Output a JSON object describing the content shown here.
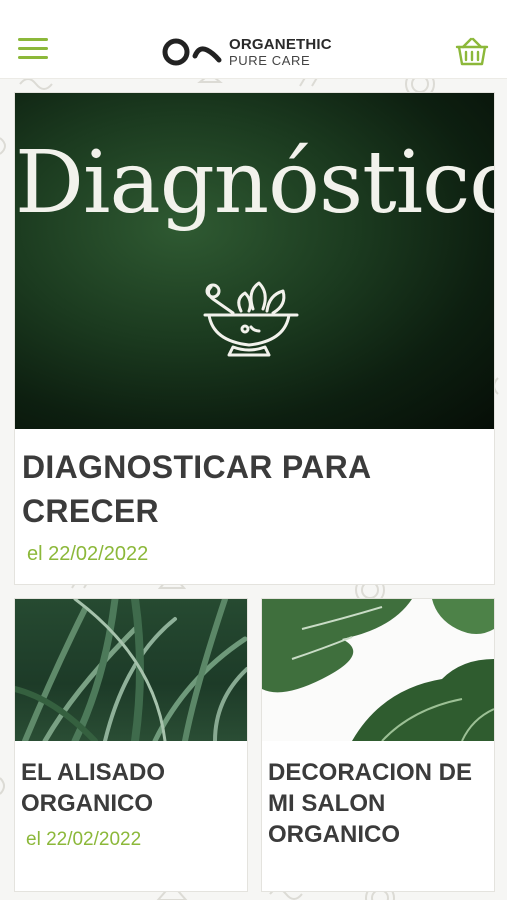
{
  "header": {
    "brand_name": "ORGANETHIC",
    "brand_tagline": "PURE CARE",
    "menu_icon": "hamburger-icon",
    "cart_icon": "basket-icon",
    "accent_color": "#8cb83a"
  },
  "featured": {
    "image_text": "Diagnóstico",
    "title": "DIAGNOSTICAR PARA CRECER",
    "date": "el 22/02/2022"
  },
  "posts": [
    {
      "title": "EL ALISADO ORGANICO",
      "date": "el 22/02/2022"
    },
    {
      "title": "DECORACION DE MI SALON ORGANICO"
    }
  ]
}
